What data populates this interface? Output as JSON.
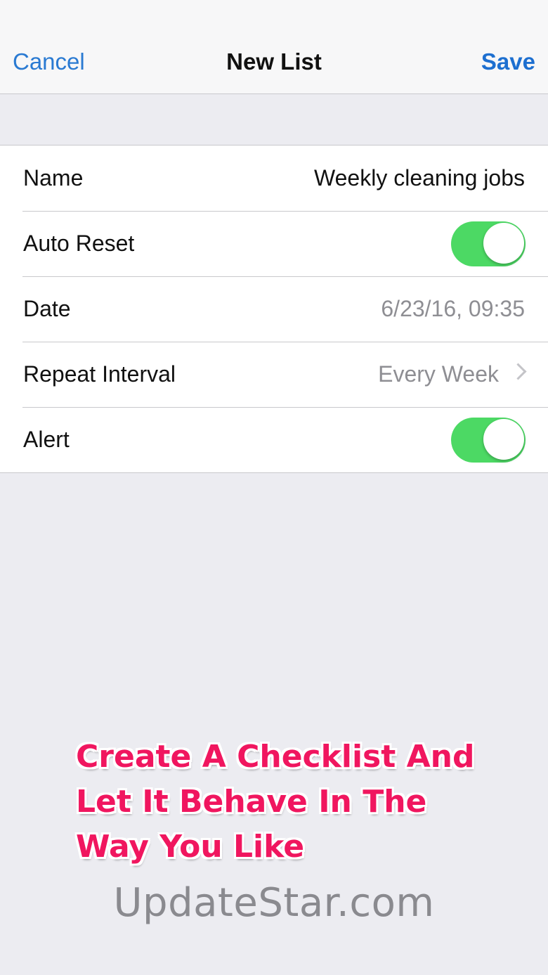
{
  "nav": {
    "cancel_label": "Cancel",
    "title": "New List",
    "save_label": "Save"
  },
  "form": {
    "name": {
      "label": "Name",
      "value": "Weekly cleaning jobs"
    },
    "auto_reset": {
      "label": "Auto Reset",
      "on": true
    },
    "date": {
      "label": "Date",
      "value": "6/23/16, 09:35"
    },
    "repeat_interval": {
      "label": "Repeat Interval",
      "value": "Every Week"
    },
    "alert": {
      "label": "Alert",
      "on": true
    }
  },
  "caption": {
    "line1": "Create A Checklist And",
    "line2": "Let It Behave In The",
    "line3": "Way You Like"
  },
  "watermark": "UpdateStar.com",
  "colors": {
    "accent_blue": "#2a7ad2",
    "toggle_green": "#4cd964",
    "caption_pink": "#f0165f",
    "background": "#ececf1"
  },
  "icons": {
    "chevron": "chevron-right-icon"
  }
}
